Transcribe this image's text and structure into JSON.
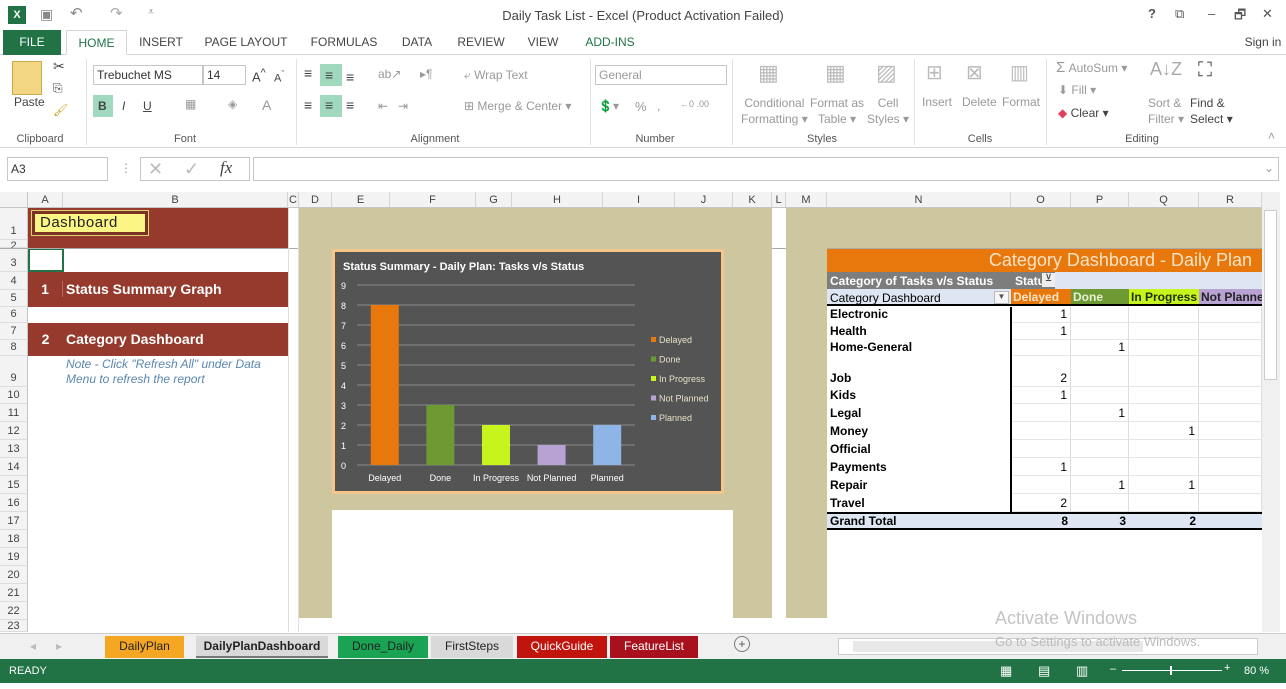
{
  "window": {
    "title": "Daily Task List - Excel (Product Activation Failed)",
    "sign_in": "Sign in",
    "controls": [
      "?",
      "⧉",
      "–",
      "🗗",
      "✕"
    ]
  },
  "ribbon_tabs": [
    "FILE",
    "HOME",
    "INSERT",
    "PAGE LAYOUT",
    "FORMULAS",
    "DATA",
    "REVIEW",
    "VIEW",
    "ADD-INS"
  ],
  "ribbon": {
    "paste": "Paste",
    "clipboard": "Clipboard",
    "font_name": "Trebuchet MS",
    "font_size": "14",
    "font": "Font",
    "bold": "B",
    "italic": "I",
    "underline": "U",
    "wrap_text": "Wrap Text",
    "merge_center": "Merge & Center",
    "alignment": "Alignment",
    "number_format": "General",
    "number": "Number",
    "conditional_formatting": [
      "Conditional",
      "Formatting"
    ],
    "format_as_table": [
      "Format as",
      "Table"
    ],
    "cell_styles": [
      "Cell",
      "Styles"
    ],
    "styles": "Styles",
    "insert": "Insert",
    "delete": "Delete",
    "format": "Format",
    "cells": "Cells",
    "autosum": "AutoSum",
    "fill": "Fill",
    "clear": "Clear",
    "sort_filter": [
      "Sort &",
      "Filter"
    ],
    "find_select": [
      "Find &",
      "Select"
    ],
    "editing": "Editing"
  },
  "formula_bar": {
    "name_box": "A3",
    "formula": ""
  },
  "columns": [
    "A",
    "B",
    "C",
    "D",
    "E",
    "F",
    "G",
    "H",
    "I",
    "J",
    "K",
    "L",
    "M",
    "N",
    "O",
    "P",
    "Q",
    "R"
  ],
  "rows": [
    "1",
    "2",
    "3",
    "4",
    "5",
    "6",
    "7",
    "8",
    "9",
    "10",
    "11",
    "12",
    "13",
    "14",
    "15",
    "16",
    "17",
    "18",
    "19",
    "20",
    "21",
    "22",
    "23"
  ],
  "sheet": {
    "dashboard_label": "Dashboard",
    "menu": [
      {
        "num": "1",
        "label": "Status Summary Graph"
      },
      {
        "num": "2",
        "label": "Category Dashboard"
      }
    ],
    "note": "Note - Click \"Refresh All\" under Data Menu to refresh the report"
  },
  "chart_data": {
    "type": "bar",
    "title": "Status Summary - Daily Plan: Tasks v/s Status",
    "categories": [
      "Delayed",
      "Done",
      "In Progress",
      "Not Planned",
      "Planned"
    ],
    "values": [
      8,
      3,
      2,
      1,
      2
    ],
    "colors": [
      "#e8780c",
      "#6e9a34",
      "#c8f41e",
      "#b8a2d4",
      "#8eb4e8"
    ],
    "ylim": [
      0,
      9
    ],
    "yticks": [
      "0",
      "1",
      "2",
      "3",
      "4",
      "5",
      "6",
      "7",
      "8",
      "9"
    ],
    "legend": [
      "Delayed",
      "Done",
      "In Progress",
      "Not Planned",
      "Planned"
    ],
    "legend_position": "right",
    "grid": true
  },
  "pivot": {
    "title": "Category Dashboard - Daily Plan",
    "subtitle": "Category of Tasks v/s Status",
    "status_label": "Status",
    "row_header": "Category Dashboard",
    "col_headers": [
      "Delayed",
      "Done",
      "In Progress",
      "Not Planne"
    ],
    "rows": [
      {
        "label": "Electronic",
        "vals": [
          "1",
          "",
          "",
          ""
        ]
      },
      {
        "label": "Health",
        "vals": [
          "1",
          "",
          "",
          ""
        ]
      },
      {
        "label": "Home-General",
        "vals": [
          "",
          "1",
          "",
          ""
        ]
      },
      {
        "label": "Job",
        "vals": [
          "2",
          "",
          "",
          ""
        ]
      },
      {
        "label": "Kids",
        "vals": [
          "1",
          "",
          "",
          ""
        ]
      },
      {
        "label": "Legal",
        "vals": [
          "",
          "1",
          "",
          ""
        ]
      },
      {
        "label": "Money",
        "vals": [
          "",
          "",
          "1",
          ""
        ]
      },
      {
        "label": "Official",
        "vals": [
          "",
          "",
          "",
          ""
        ]
      },
      {
        "label": "Payments",
        "vals": [
          "1",
          "",
          "",
          ""
        ]
      },
      {
        "label": "Repair",
        "vals": [
          "",
          "1",
          "1",
          ""
        ]
      },
      {
        "label": "Travel",
        "vals": [
          "2",
          "",
          "",
          ""
        ]
      }
    ],
    "grand_total": {
      "label": "Grand Total",
      "vals": [
        "8",
        "3",
        "2",
        ""
      ]
    }
  },
  "sheet_tabs": [
    {
      "label": "DailyPlan",
      "color": "#f5a623"
    },
    {
      "label": "DailyPlanDashboard",
      "color": "#d9d9d9"
    },
    {
      "label": "Done_Daily",
      "color": "#1aa353"
    },
    {
      "label": "FirstSteps",
      "color": "#d9d9d9"
    },
    {
      "label": "QuickGuide",
      "color": "#c0140c"
    },
    {
      "label": "FeatureList",
      "color": "#a8101e"
    }
  ],
  "status": {
    "ready": "READY",
    "zoom": "80 %"
  },
  "watermark": {
    "line1": "Activate Windows",
    "line2": "Go to Settings to activate Windows."
  }
}
